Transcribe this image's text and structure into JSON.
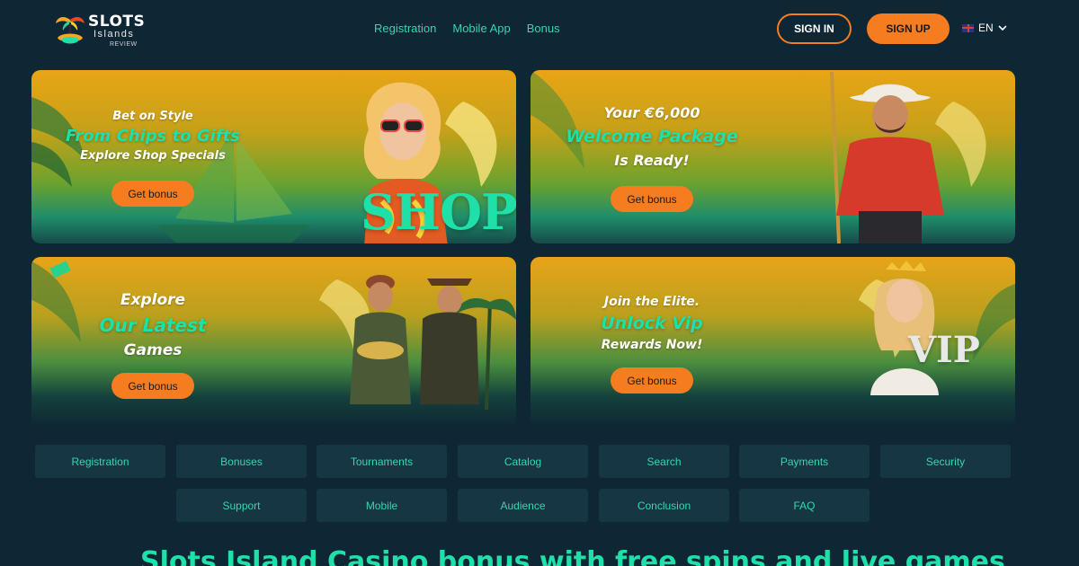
{
  "header": {
    "logo": {
      "line1": "SLOTS",
      "line2": "Islands",
      "line3": "REVIEW"
    },
    "nav": [
      "Registration",
      "Mobile App",
      "Bonus"
    ],
    "signin": "SIGN IN",
    "signup": "SIGN UP",
    "language": "EN"
  },
  "banners": [
    {
      "line1": "Bet on Style",
      "line2": "From Chips to Gifts",
      "line3": "Explore Shop Specials",
      "button": "Get bonus",
      "badge": "SHOP"
    },
    {
      "line1": "Your €6,000",
      "line2": "Welcome Package",
      "line3": "Is Ready!",
      "button": "Get bonus"
    },
    {
      "line1": "Explore",
      "line2": "Our Latest",
      "line3": "Games",
      "button": "Get bonus"
    },
    {
      "line1": "Join the Elite.",
      "line2": "Unlock Vip",
      "line3": "Rewards Now!",
      "button": "Get bonus",
      "badge": "VIP"
    }
  ],
  "categories": [
    "Registration",
    "Bonuses",
    "Tournaments",
    "Catalog",
    "Search",
    "Payments",
    "Security",
    "Support",
    "Mobile",
    "Audience",
    "Conclusion",
    "FAQ"
  ],
  "page_heading": "Slots Island Casino bonus with free spins and live games",
  "colors": {
    "background": "#0f2634",
    "accent_orange": "#f57c1f",
    "accent_teal": "#36d6b0",
    "category_bg": "#163644"
  }
}
